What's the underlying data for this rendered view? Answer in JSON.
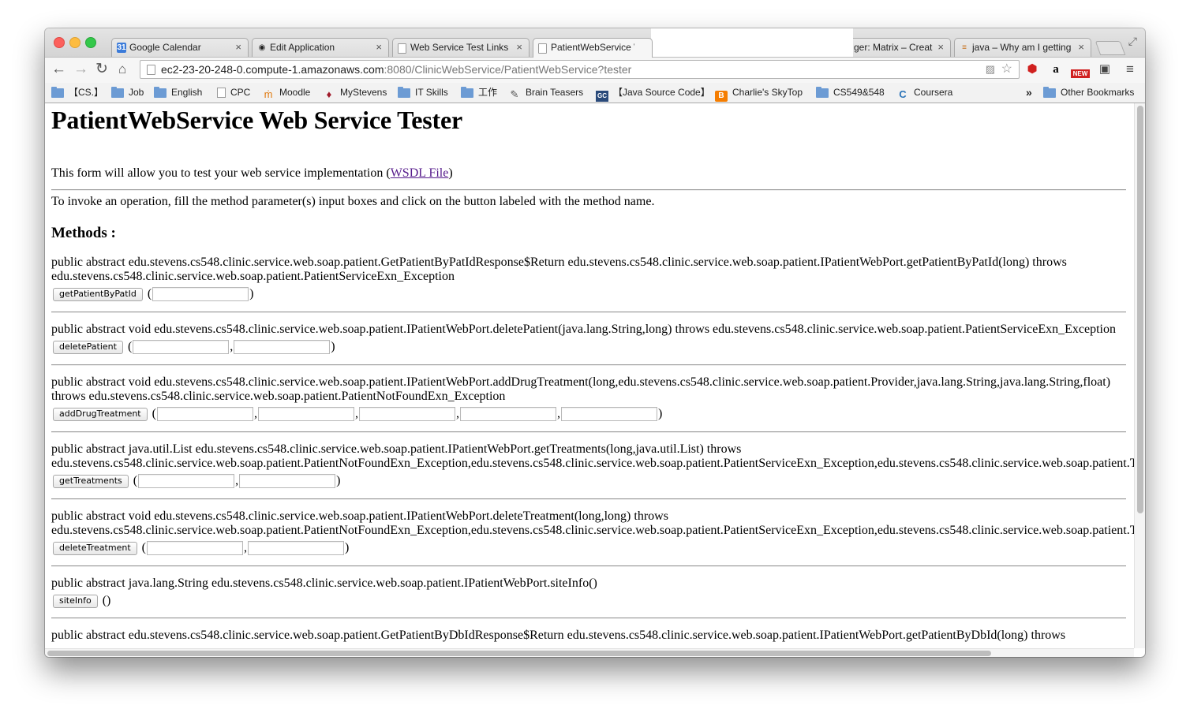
{
  "tabs": [
    {
      "title": "Google Calendar",
      "icon": "calendar-icon"
    },
    {
      "title": "Edit Application",
      "icon": "eye-icon"
    },
    {
      "title": "Web Service Test Links",
      "icon": "page-icon"
    },
    {
      "title": "PatientWebService Web",
      "icon": "page-icon"
    },
    {
      "title": "ger: Matrix – Creat",
      "icon": "none"
    },
    {
      "title": "java – Why am I getting",
      "icon": "stackoverflow-icon"
    }
  ],
  "address_bar": {
    "host": "ec2-23-20-248-0.compute-1.amazonaws.com",
    "rest": ":8080/ClinicWebService/PatientWebService?tester"
  },
  "extensions": {
    "amazon_glyph": "a",
    "new_badge": "NEW"
  },
  "bookmarks": [
    {
      "label": "【CS.】",
      "icon": "folder-icon"
    },
    {
      "label": "Job",
      "icon": "folder-icon"
    },
    {
      "label": "English",
      "icon": "folder-icon"
    },
    {
      "label": "CPC",
      "icon": "page-icon"
    },
    {
      "label": "Moodle",
      "icon": "moodle-icon"
    },
    {
      "label": "MyStevens",
      "icon": "stevens-icon"
    },
    {
      "label": "IT Skills",
      "icon": "folder-icon"
    },
    {
      "label": "工作",
      "icon": "folder-icon"
    },
    {
      "label": "Brain Teasers",
      "icon": "puzzle-icon"
    },
    {
      "label": "【Java Source Code】",
      "icon": "gc-icon"
    },
    {
      "label": "Charlie's SkyTop",
      "icon": "blogger-icon"
    },
    {
      "label": "CS549&548",
      "icon": "folder-icon"
    },
    {
      "label": "Coursera",
      "icon": "coursera-icon"
    }
  ],
  "bookmarks_overflow": "»",
  "other_bookmarks": "Other Bookmarks",
  "page": {
    "title": "PatientWebService Web Service Tester",
    "intro_before": "This form will allow you to test your web service implementation (",
    "wsdl_link": "WSDL File",
    "intro_after": ")",
    "instructions": "To invoke an operation, fill the method parameter(s) input boxes and click on the button labeled with the method name.",
    "methods_heading": "Methods :"
  },
  "methods": [
    {
      "line1": "public abstract edu.stevens.cs548.clinic.service.web.soap.patient.GetPatientByPatIdResponse$Return edu.stevens.cs548.clinic.service.web.soap.patient.IPatientWebPort.getPatientByPatId(long) throws",
      "line2": "edu.stevens.cs548.clinic.service.web.soap.patient.PatientServiceExn_Exception",
      "button": "getPatientByPatId",
      "params": 1
    },
    {
      "line1": "public abstract void edu.stevens.cs548.clinic.service.web.soap.patient.IPatientWebPort.deletePatient(java.lang.String,long) throws edu.stevens.cs548.clinic.service.web.soap.patient.PatientServiceExn_Exception",
      "line2": "",
      "button": "deletePatient",
      "params": 2
    },
    {
      "line1": "public abstract void edu.stevens.cs548.clinic.service.web.soap.patient.IPatientWebPort.addDrugTreatment(long,edu.stevens.cs548.clinic.service.web.soap.patient.Provider,java.lang.String,java.lang.String,float)",
      "line2": "throws edu.stevens.cs548.clinic.service.web.soap.patient.PatientNotFoundExn_Exception",
      "button": "addDrugTreatment",
      "params": 5
    },
    {
      "line1": "public abstract java.util.List edu.stevens.cs548.clinic.service.web.soap.patient.IPatientWebPort.getTreatments(long,java.util.List) throws",
      "line2": "edu.stevens.cs548.clinic.service.web.soap.patient.PatientNotFoundExn_Exception,edu.stevens.cs548.clinic.service.web.soap.patient.PatientServiceExn_Exception,edu.stevens.cs548.clinic.service.web.soap.patient.Trea",
      "button": "getTreatments",
      "params": 2
    },
    {
      "line1": "public abstract void edu.stevens.cs548.clinic.service.web.soap.patient.IPatientWebPort.deleteTreatment(long,long) throws",
      "line2": "edu.stevens.cs548.clinic.service.web.soap.patient.PatientNotFoundExn_Exception,edu.stevens.cs548.clinic.service.web.soap.patient.PatientServiceExn_Exception,edu.stevens.cs548.clinic.service.web.soap.patient.Trea",
      "button": "deleteTreatment",
      "params": 2
    },
    {
      "line1": "public abstract java.lang.String edu.stevens.cs548.clinic.service.web.soap.patient.IPatientWebPort.siteInfo()",
      "line2": "",
      "button": "siteInfo",
      "params": 0
    },
    {
      "line1": "public abstract edu.stevens.cs548.clinic.service.web.soap.patient.GetPatientByDbIdResponse$Return edu.stevens.cs548.clinic.service.web.soap.patient.IPatientWebPort.getPatientByDbId(long) throws",
      "line2": "",
      "button": "",
      "params": 0
    }
  ],
  "symbols": {
    "open_paren": "(",
    "close_paren": ")",
    "comma": ",",
    "empty_parens": "()"
  },
  "colors": {
    "link_visited": "#551a8b",
    "close_button": "#fc605c",
    "minimize_button": "#fdbc40",
    "maximize_button": "#34c84a"
  }
}
